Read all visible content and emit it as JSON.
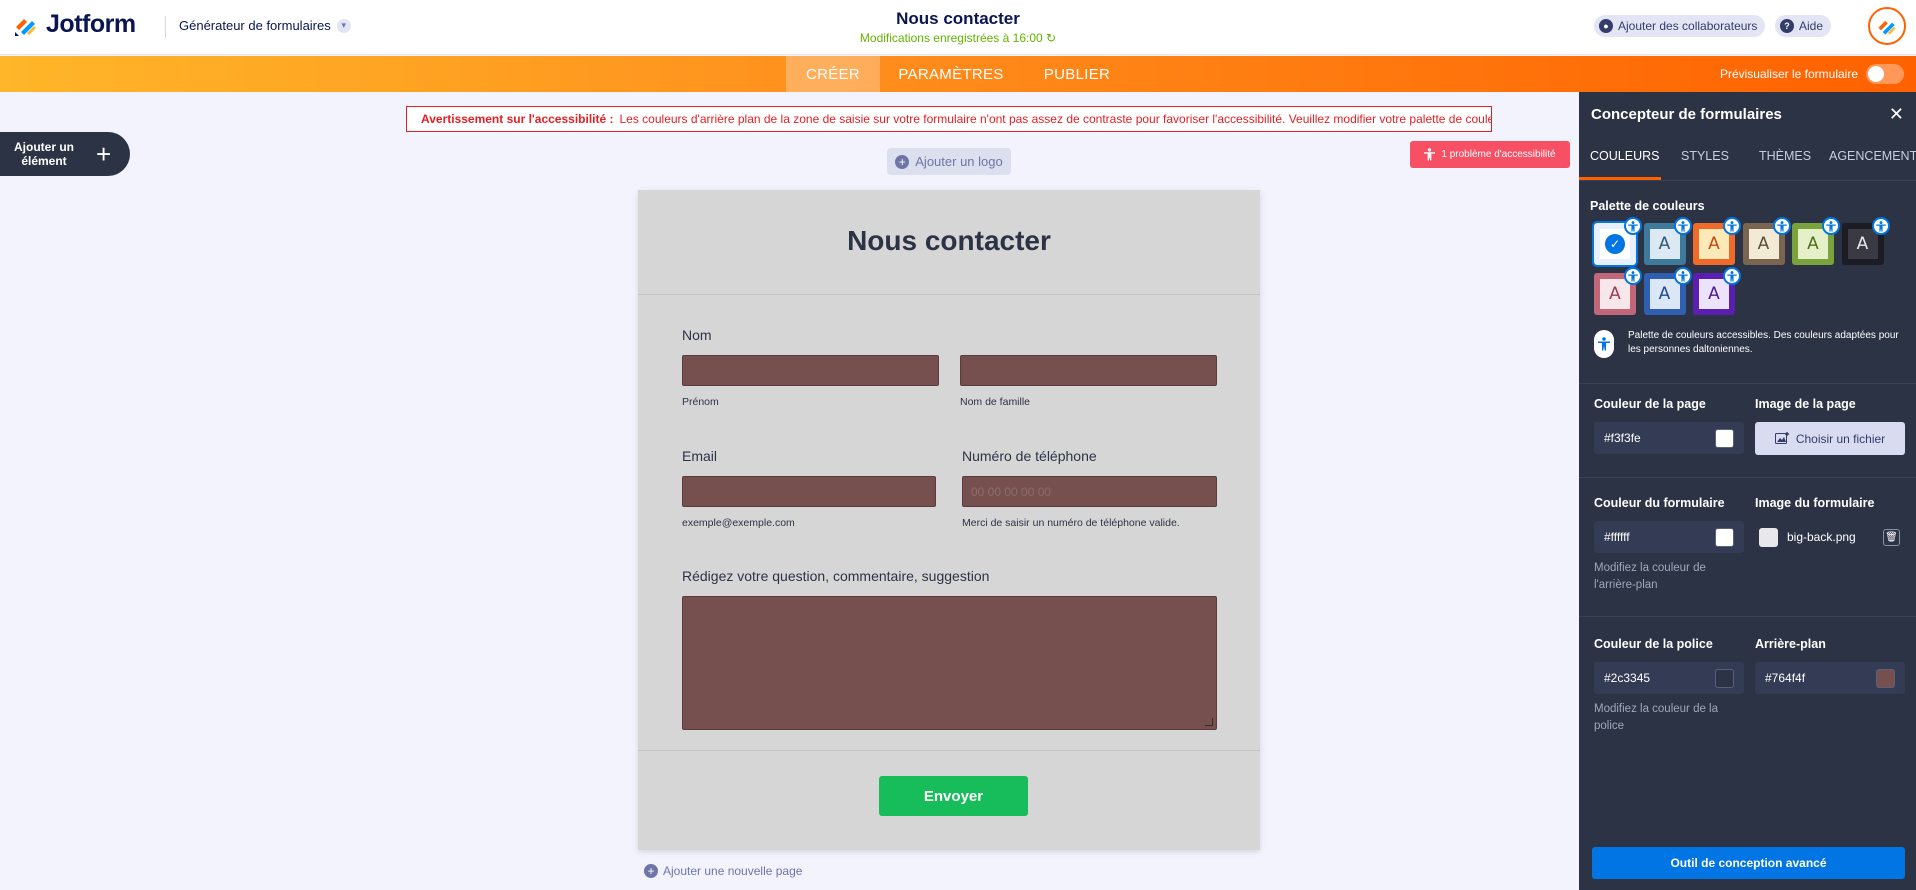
{
  "header": {
    "brand": "Jotform",
    "builder_label": "Générateur de formulaires",
    "form_title": "Nous contacter",
    "saved_status": "Modifications enregistrées à 16:00",
    "collaborators_label": "Ajouter des collaborateurs",
    "help_label": "Aide"
  },
  "nav": {
    "tabs": [
      "CRÉER",
      "PARAMÈTRES",
      "PUBLIER"
    ],
    "active_tab": "CRÉER",
    "preview_label": "Prévisualiser le formulaire"
  },
  "canvas": {
    "add_element_label": "Ajouter un élément",
    "warning_title": "Avertissement sur l'accessibilité :",
    "warning_text": "Les couleurs d'arrière plan de la zone de saisie sur votre formulaire n'ont pas assez de contraste pour favoriser l'accessibilité. Veuillez modifier votre palette de couleurs.",
    "accessibility_issue_label": "1 problème d'accessibilité",
    "add_logo_label": "Ajouter un logo",
    "add_page_label": "Ajouter une nouvelle page"
  },
  "form": {
    "title": "Nous contacter",
    "name_label": "Nom",
    "first_name_sub": "Prénom",
    "last_name_sub": "Nom de famille",
    "email_label": "Email",
    "email_sub": "exemple@exemple.com",
    "phone_label": "Numéro de téléphone",
    "phone_placeholder": "00 00 00 00 00",
    "phone_sub": "Merci de saisir un numéro de téléphone valide.",
    "comment_label": "Rédigez votre question, commentaire, suggestion",
    "submit_label": "Envoyer"
  },
  "panel": {
    "title": "Concepteur de formulaires",
    "tabs": [
      "COULEURS",
      "STYLES",
      "THÈMES",
      "AGENCEMENT"
    ],
    "active_tab": "COULEURS",
    "palette_label": "Palette de couleurs",
    "swatches": [
      {
        "letter": "",
        "outer": "#e8f0ff",
        "inner": "#ffffff",
        "text": "#0075e3",
        "selected": true
      },
      {
        "letter": "A",
        "outer": "#3d7a9c",
        "inner": "#dce9f2",
        "text": "#2c5a78",
        "selected": false
      },
      {
        "letter": "A",
        "outer": "#f06a2a",
        "inner": "#fce9b8",
        "text": "#c34a14",
        "selected": false
      },
      {
        "letter": "A",
        "outer": "#7a6650",
        "inner": "#f3ead6",
        "text": "#5a4a38",
        "selected": false
      },
      {
        "letter": "A",
        "outer": "#7ba33b",
        "inner": "#e6f0c8",
        "text": "#4d6e1c",
        "selected": false
      },
      {
        "letter": "A",
        "outer": "#1c1c24",
        "inner": "#3a3a44",
        "text": "#e8e8ee",
        "selected": false
      },
      {
        "letter": "A",
        "outer": "#c2677a",
        "inner": "#f7e6ea",
        "text": "#a03a52",
        "selected": false
      },
      {
        "letter": "A",
        "outer": "#2f5fb0",
        "inner": "#dbe6f7",
        "text": "#1f4a94",
        "selected": false
      },
      {
        "letter": "A",
        "outer": "#5a1fb0",
        "inner": "#ece3fb",
        "text": "#4a1a9a",
        "selected": false
      }
    ],
    "accessible_note": "Palette de couleurs accessibles. Des couleurs adaptées pour les personnes daltoniennes.",
    "page_color_label": "Couleur de la page",
    "page_color_value": "#f3f3fe",
    "page_image_label": "Image de la page",
    "choose_file_label": "Choisir un fichier",
    "form_color_label": "Couleur du formulaire",
    "form_color_value": "#ffffff",
    "form_image_label": "Image du formulaire",
    "form_image_file": "big-back.png",
    "form_color_hint": "Modifiez la couleur de l'arrière-plan",
    "font_color_label": "Couleur de la police",
    "font_color_value": "#2c3345",
    "background_label": "Arrière-plan",
    "background_value": "#764f4f",
    "font_color_hint": "Modifiez la couleur de la police",
    "advanced_label": "Outil de conception avancé"
  },
  "colors": {
    "accent_orange": "#ff6100",
    "panel_bg": "#2c3345",
    "submit_green": "#18bd5b",
    "input_bg": "#764f4f",
    "warning_red": "#e42025",
    "primary_blue": "#0075e3"
  }
}
